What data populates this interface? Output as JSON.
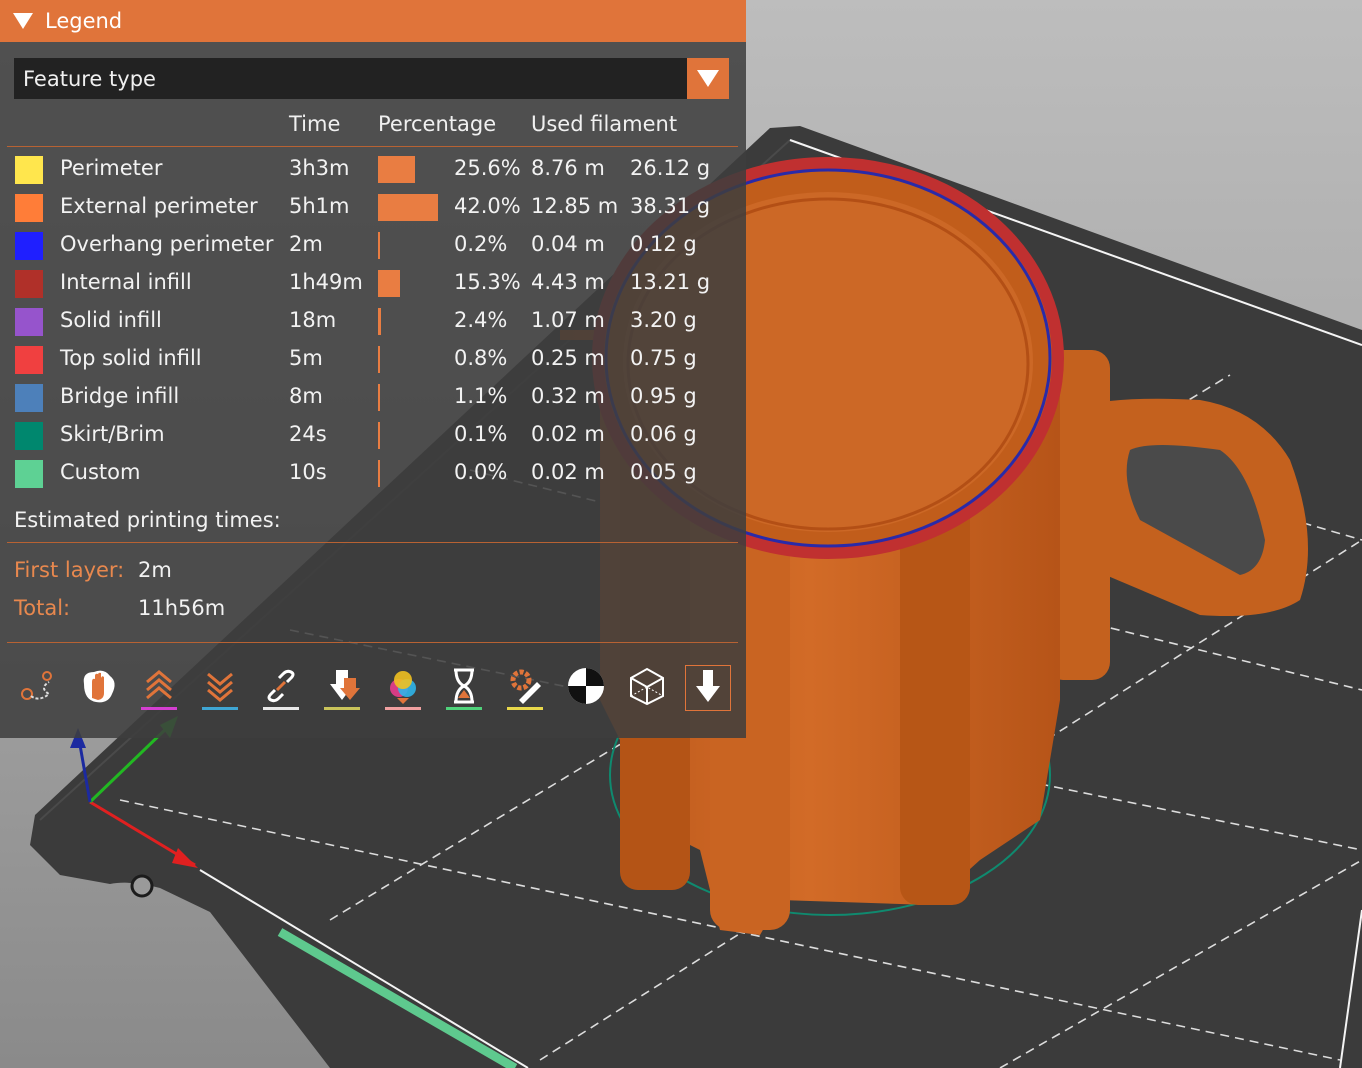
{
  "legend": {
    "title": "Legend",
    "view_type": "Feature type",
    "columns": {
      "time": "Time",
      "percentage": "Percentage",
      "used_filament": "Used filament"
    },
    "rows": [
      {
        "name": "Perimeter",
        "color": "#ffe64d",
        "time": "3h3m",
        "percentage": "25.6%",
        "percent_value": 25.6,
        "length": "8.76 m",
        "weight": "26.12 g"
      },
      {
        "name": "External perimeter",
        "color": "#ff7d38",
        "time": "5h1m",
        "percentage": "42.0%",
        "percent_value": 42.0,
        "length": "12.85 m",
        "weight": "38.31 g"
      },
      {
        "name": "Overhang perimeter",
        "color": "#1f1fff",
        "time": "2m",
        "percentage": "0.2%",
        "percent_value": 0.2,
        "length": "0.04 m",
        "weight": "0.12 g"
      },
      {
        "name": "Internal infill",
        "color": "#b03029",
        "time": "1h49m",
        "percentage": "15.3%",
        "percent_value": 15.3,
        "length": "4.43 m",
        "weight": "13.21 g"
      },
      {
        "name": "Solid infill",
        "color": "#9654cc",
        "time": "18m",
        "percentage": "2.4%",
        "percent_value": 2.4,
        "length": "1.07 m",
        "weight": "3.20 g"
      },
      {
        "name": "Top solid infill",
        "color": "#f04040",
        "time": "5m",
        "percentage": "0.8%",
        "percent_value": 0.8,
        "length": "0.25 m",
        "weight": "0.75 g"
      },
      {
        "name": "Bridge infill",
        "color": "#4d80ba",
        "time": "8m",
        "percentage": "1.1%",
        "percent_value": 1.1,
        "length": "0.32 m",
        "weight": "0.95 g"
      },
      {
        "name": "Skirt/Brim",
        "color": "#00876e",
        "time": "24s",
        "percentage": "0.1%",
        "percent_value": 0.1,
        "length": "0.02 m",
        "weight": "0.06 g"
      },
      {
        "name": "Custom",
        "color": "#5ed194",
        "time": "10s",
        "percentage": "0.0%",
        "percent_value": 0.0,
        "length": "0.02 m",
        "weight": "0.05 g"
      }
    ],
    "estimated_title": "Estimated printing times:",
    "first_layer_label": "First layer:",
    "first_layer_value": "2m",
    "total_label": "Total:",
    "total_value": "11h56m"
  },
  "toolbar": [
    {
      "icon": "travel-icon",
      "underline": ""
    },
    {
      "icon": "wipe-icon",
      "underline": ""
    },
    {
      "icon": "retractions-icon",
      "underline": "#d43fd1"
    },
    {
      "icon": "deretractions-icon",
      "underline": "#3fa6d4"
    },
    {
      "icon": "seams-icon",
      "underline": "#e8e8e8"
    },
    {
      "icon": "tool-changes-icon",
      "underline": "#c9c35a"
    },
    {
      "icon": "color-changes-icon",
      "underline": "#f0a0a0"
    },
    {
      "icon": "pause-prints-icon",
      "underline": "#4fd27a"
    },
    {
      "icon": "custom-gcodes-icon",
      "underline": "#e8d84a"
    },
    {
      "icon": "center-of-gravity-icon",
      "underline": ""
    },
    {
      "icon": "shells-icon",
      "underline": ""
    },
    {
      "icon": "tool-marker-icon",
      "underline": "",
      "selected": true
    }
  ],
  "colors": {
    "accent": "#e0743a",
    "model": "#c9621f",
    "bed": "#3a3a3a"
  }
}
